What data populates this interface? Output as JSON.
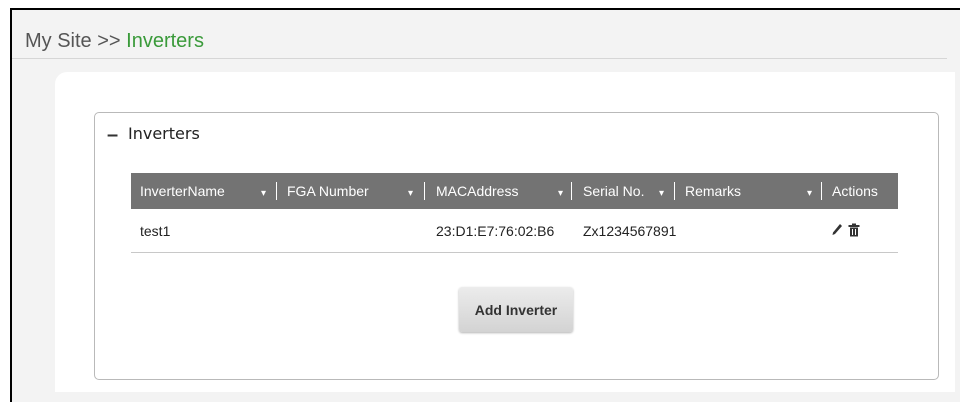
{
  "breadcrumb": {
    "root": "My Site >> ",
    "current": "Inverters"
  },
  "panel": {
    "toggle": "–",
    "title": "Inverters"
  },
  "table": {
    "columns": [
      {
        "label": "InverterName",
        "sort": "▾"
      },
      {
        "label": "FGA Number",
        "sort": "▾"
      },
      {
        "label": "MACAddress",
        "sort": "▾"
      },
      {
        "label": "Serial No.",
        "sort": "▾"
      },
      {
        "label": "Remarks",
        "sort": "▾"
      },
      {
        "label": "Actions"
      }
    ],
    "rows": [
      {
        "inverter_name": "test1",
        "fga_number": "",
        "mac_address": "23:D1:E7:76:02:B6",
        "serial_no": "Zx1234567891",
        "remarks": "",
        "actions": [
          "edit-icon",
          "delete-icon"
        ]
      }
    ]
  },
  "add_button": "Add Inverter",
  "colors": {
    "accent": "#3a9a3a",
    "header_bg": "#737373"
  }
}
